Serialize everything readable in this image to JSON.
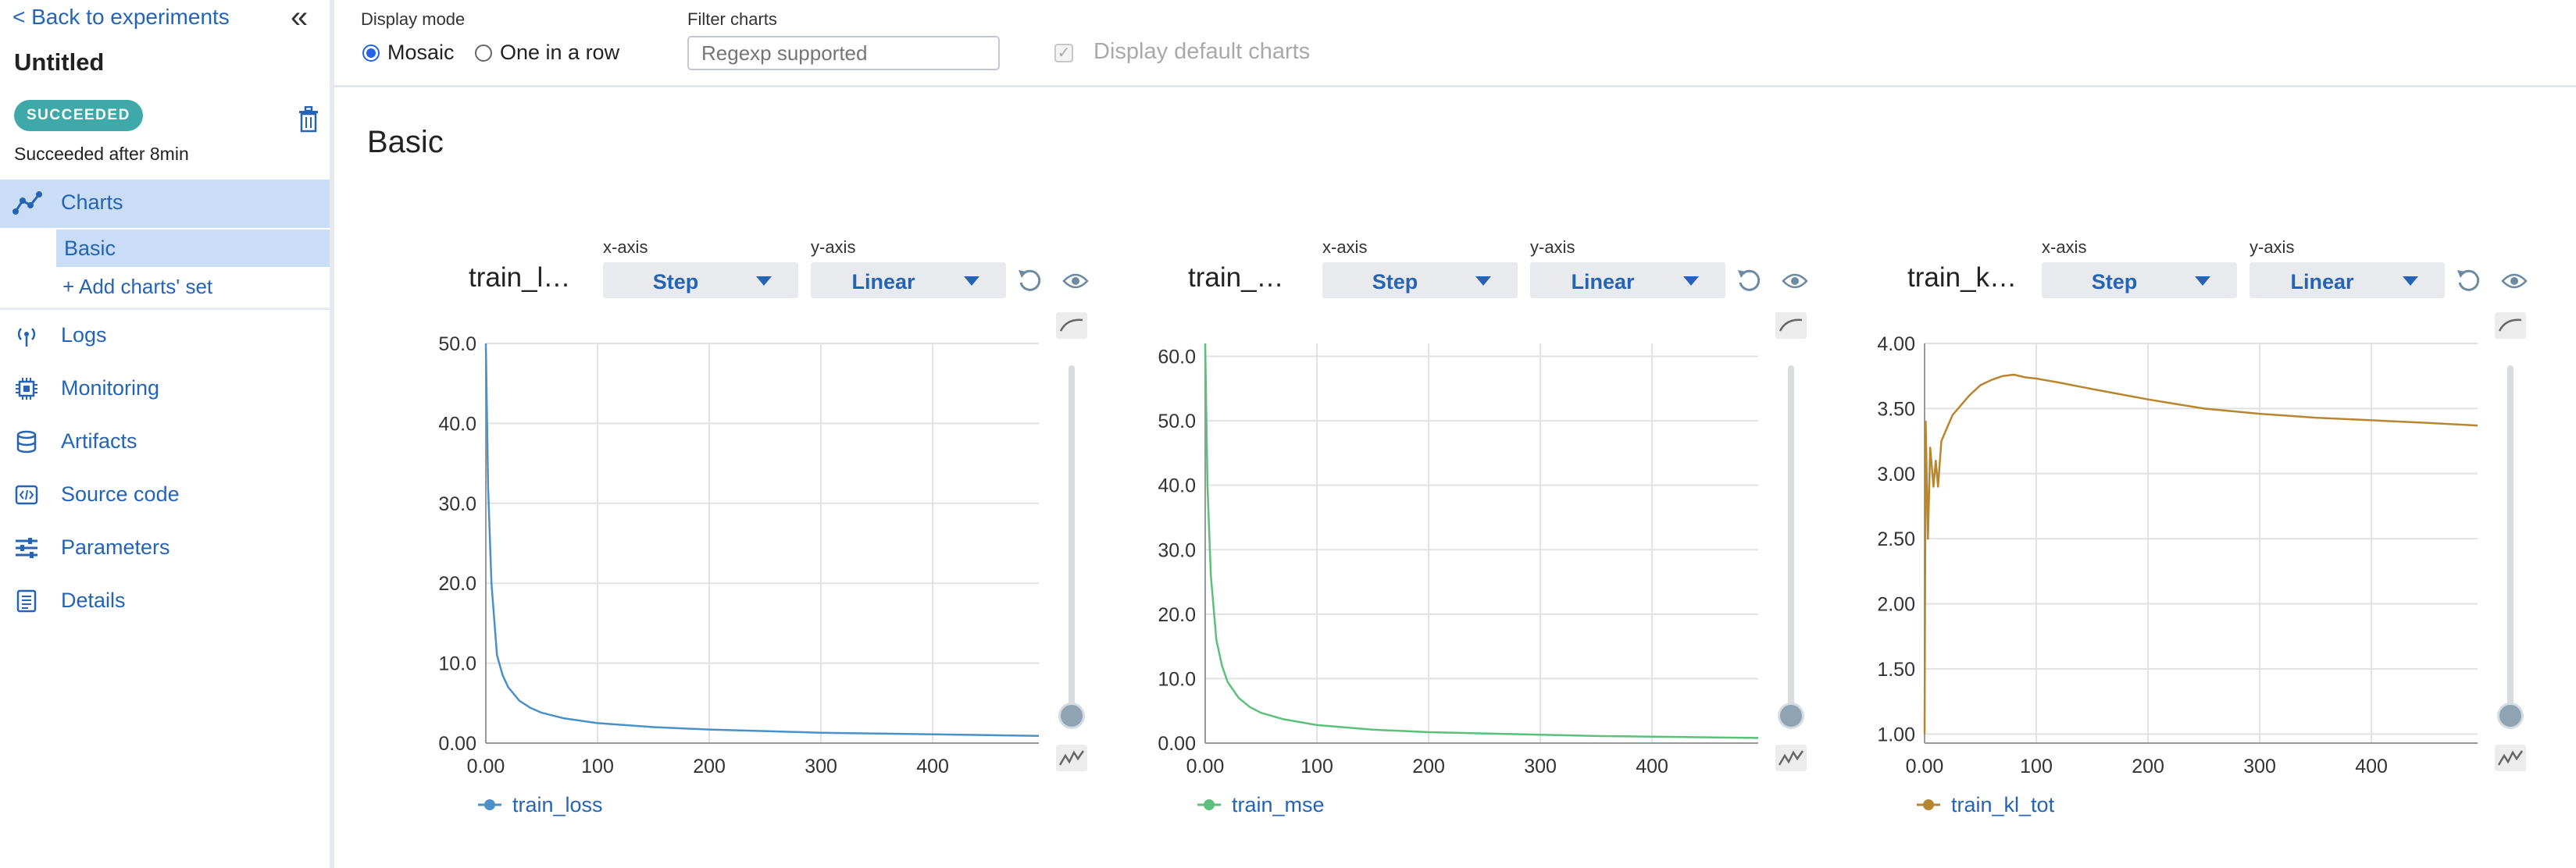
{
  "sidebar": {
    "back_label": "< Back to experiments",
    "collapse_glyph": "«",
    "title": "Untitled",
    "status_badge": "SUCCEEDED",
    "status_text": "Succeeded after 8min",
    "nav": {
      "charts": "Charts",
      "basic": "Basic",
      "add_set": "+ Add charts' set",
      "logs": "Logs",
      "monitoring": "Monitoring",
      "artifacts": "Artifacts",
      "source_code": "Source code",
      "parameters": "Parameters",
      "details": "Details"
    },
    "icons": {
      "charts": "chart-line-icon",
      "logs": "broadcast-icon",
      "monitoring": "chip-icon",
      "artifacts": "database-icon",
      "source_code": "code-icon",
      "parameters": "sliders-icon",
      "details": "document-icon",
      "delete": "trash-icon"
    }
  },
  "toolbar": {
    "display_mode_label": "Display mode",
    "mosaic_label": "Mosaic",
    "one_in_row_label": "One in a row",
    "selected_mode": "Mosaic",
    "filter_label": "Filter charts",
    "filter_placeholder": "Regexp supported",
    "filter_value": "",
    "default_charts_label": "Display default charts",
    "default_charts_checked": true
  },
  "section_title": "Basic",
  "colors": {
    "accent": "#2563b5",
    "badge": "#3fa8a8",
    "selected_nav_bg": "#c9ddf6",
    "train_loss": "#4a90c9",
    "train_mse": "#5cc07a",
    "train_kl_tot": "#b8862e"
  },
  "panels": [
    {
      "title": "train_l…",
      "xaxis_caption": "x-axis",
      "xaxis_value": "Step",
      "yaxis_caption": "y-axis",
      "yaxis_value": "Linear",
      "legend": "train_loss",
      "color_key": "train_loss"
    },
    {
      "title": "train_…",
      "xaxis_caption": "x-axis",
      "xaxis_value": "Step",
      "yaxis_caption": "y-axis",
      "yaxis_value": "Linear",
      "legend": "train_mse",
      "color_key": "train_mse"
    },
    {
      "title": "train_k…",
      "xaxis_caption": "x-axis",
      "xaxis_value": "Step",
      "yaxis_caption": "y-axis",
      "yaxis_value": "Linear",
      "legend": "train_kl_tot",
      "color_key": "train_kl_tot"
    }
  ],
  "chart_data": [
    {
      "type": "line",
      "series": [
        {
          "name": "train_loss"
        }
      ],
      "x": [
        0,
        2,
        5,
        10,
        15,
        20,
        30,
        40,
        50,
        70,
        100,
        150,
        200,
        250,
        300,
        350,
        400,
        450,
        495
      ],
      "y": [
        50.0,
        32.0,
        20.0,
        11.0,
        8.5,
        7.0,
        5.3,
        4.4,
        3.8,
        3.1,
        2.5,
        2.0,
        1.7,
        1.5,
        1.3,
        1.2,
        1.1,
        1.0,
        0.9
      ],
      "xlim": [
        0,
        495
      ],
      "ylim": [
        0,
        50
      ],
      "xticks": [
        "0.00",
        "100",
        "200",
        "300",
        "400"
      ],
      "yticks": [
        "0.00",
        "10.0",
        "20.0",
        "30.0",
        "40.0",
        "50.0"
      ],
      "grid": true,
      "legend": "bottom-left"
    },
    {
      "type": "line",
      "series": [
        {
          "name": "train_mse"
        }
      ],
      "x": [
        0,
        2,
        5,
        10,
        15,
        20,
        30,
        40,
        50,
        70,
        100,
        150,
        200,
        250,
        300,
        350,
        400,
        450,
        495
      ],
      "y": [
        62.0,
        40.0,
        26.0,
        16.0,
        12.0,
        9.5,
        7.0,
        5.6,
        4.7,
        3.7,
        2.8,
        2.1,
        1.7,
        1.5,
        1.3,
        1.1,
        1.0,
        0.9,
        0.8
      ],
      "xlim": [
        0,
        495
      ],
      "ylim": [
        0,
        62
      ],
      "xticks": [
        "0.00",
        "100",
        "200",
        "300",
        "400"
      ],
      "yticks": [
        "0.00",
        "10.0",
        "20.0",
        "30.0",
        "40.0",
        "50.0",
        "60.0"
      ],
      "grid": true,
      "legend": "bottom-left"
    },
    {
      "type": "line",
      "series": [
        {
          "name": "train_kl_tot"
        }
      ],
      "x": [
        0,
        1,
        3,
        5,
        8,
        10,
        12,
        15,
        20,
        25,
        30,
        40,
        50,
        60,
        70,
        80,
        90,
        100,
        120,
        150,
        200,
        250,
        300,
        350,
        400,
        450,
        495
      ],
      "y": [
        1.0,
        3.4,
        2.5,
        3.2,
        2.9,
        3.1,
        2.9,
        3.25,
        3.35,
        3.45,
        3.5,
        3.6,
        3.68,
        3.72,
        3.75,
        3.76,
        3.74,
        3.73,
        3.7,
        3.65,
        3.57,
        3.5,
        3.46,
        3.43,
        3.41,
        3.39,
        3.37
      ],
      "xlim": [
        0,
        495
      ],
      "ylim": [
        0.93,
        4.0
      ],
      "xticks": [
        "0.00",
        "100",
        "200",
        "300",
        "400"
      ],
      "yticks": [
        "1.00",
        "1.50",
        "2.00",
        "2.50",
        "3.00",
        "3.50",
        "4.00"
      ],
      "grid": true,
      "legend": "bottom-left"
    }
  ]
}
